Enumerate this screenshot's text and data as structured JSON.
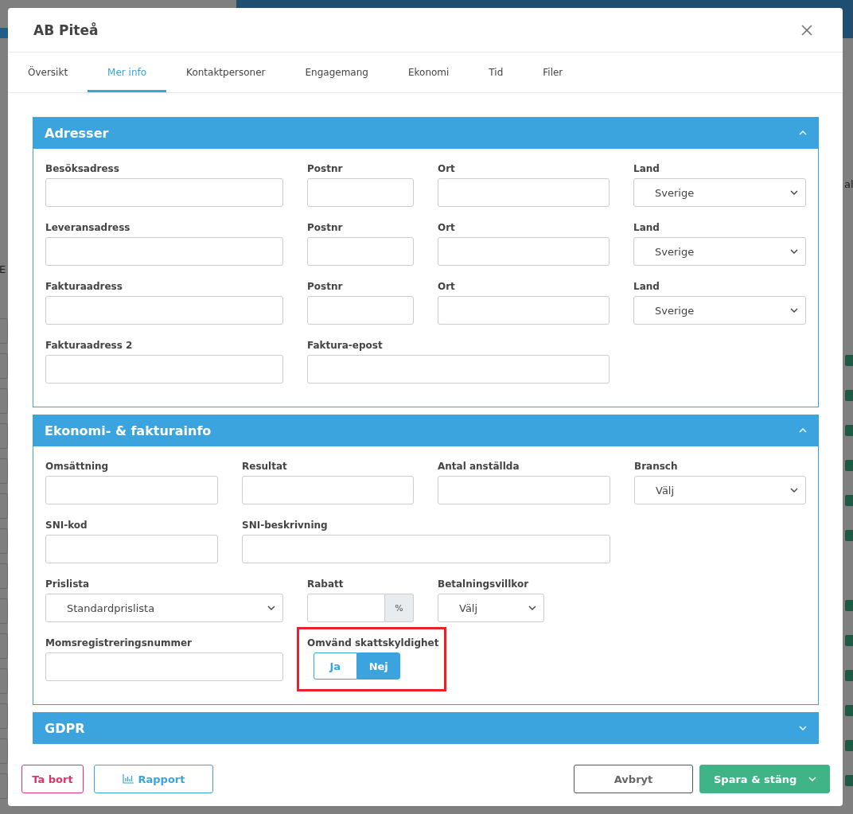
{
  "background": {
    "fragments_left": [
      "E"
    ],
    "fragments_right": [
      "al"
    ]
  },
  "dialog": {
    "title": "AB Piteå"
  },
  "tabs": [
    {
      "label": "Översikt",
      "selected": false
    },
    {
      "label": "Mer info",
      "selected": true
    },
    {
      "label": "Kontaktpersoner",
      "selected": false
    },
    {
      "label": "Engagemang",
      "selected": false
    },
    {
      "label": "Ekonomi",
      "selected": false
    },
    {
      "label": "Tid",
      "selected": false
    },
    {
      "label": "Filer",
      "selected": false
    }
  ],
  "sections": [
    {
      "title": "Adresser",
      "expanded": true,
      "rows": [
        [
          {
            "label": "Besöksadress",
            "kind": "text"
          },
          {
            "label": "Postnr",
            "kind": "text"
          },
          {
            "label": "Ort",
            "kind": "text"
          },
          {
            "label": "Land",
            "kind": "select",
            "value": "Sverige"
          }
        ],
        [
          {
            "label": "Leveransadress",
            "kind": "text"
          },
          {
            "label": "Postnr",
            "kind": "text"
          },
          {
            "label": "Ort",
            "kind": "text"
          },
          {
            "label": "Land",
            "kind": "select",
            "value": "Sverige"
          }
        ],
        [
          {
            "label": "Fakturaadress",
            "kind": "text"
          },
          {
            "label": "Postnr",
            "kind": "text"
          },
          {
            "label": "Ort",
            "kind": "text"
          },
          {
            "label": "Land",
            "kind": "select",
            "value": "Sverige"
          }
        ],
        [
          {
            "label": "Fakturaadress 2",
            "kind": "text"
          },
          {
            "label": "Faktura-epost",
            "kind": "wide"
          }
        ]
      ]
    },
    {
      "title": "Ekonomi- & fakturainfo",
      "expanded": true,
      "rows": [
        [
          {
            "label": "Omsättning",
            "kind": "text"
          },
          {
            "label": "Resultat",
            "kind": "text"
          },
          {
            "label": "Antal anställda",
            "kind": "text"
          },
          {
            "label": "Bransch",
            "kind": "select",
            "value": "Välj"
          }
        ],
        [
          {
            "label": "SNI-kod",
            "kind": "text"
          },
          {
            "label": "SNI-beskrivning",
            "kind": "wide"
          }
        ],
        [
          {
            "label": "Prislista",
            "kind": "select",
            "value": "Standardprislista"
          },
          {
            "label": "Rabatt",
            "kind": "percent",
            "suffix": "%"
          },
          {
            "label": "Betalningsvillkor",
            "kind": "select_small",
            "value": "Välj"
          }
        ],
        [
          {
            "label": "Momsregistreringsnummer",
            "kind": "text"
          },
          {
            "label": "Omvänd skattskyldighet",
            "kind": "toggle",
            "highlighted": true,
            "options": [
              {
                "label": "Ja",
                "selected": false
              },
              {
                "label": "Nej",
                "selected": true
              }
            ]
          }
        ]
      ]
    },
    {
      "title": "GDPR",
      "expanded": false
    }
  ],
  "footer": {
    "left": [
      {
        "label": "Ta bort",
        "kind": "danger"
      },
      {
        "label": "Rapport",
        "kind": "report"
      }
    ],
    "right": [
      {
        "label": "Avbryt",
        "kind": "cancel"
      },
      {
        "label": "Spara & stäng",
        "kind": "save"
      }
    ]
  }
}
